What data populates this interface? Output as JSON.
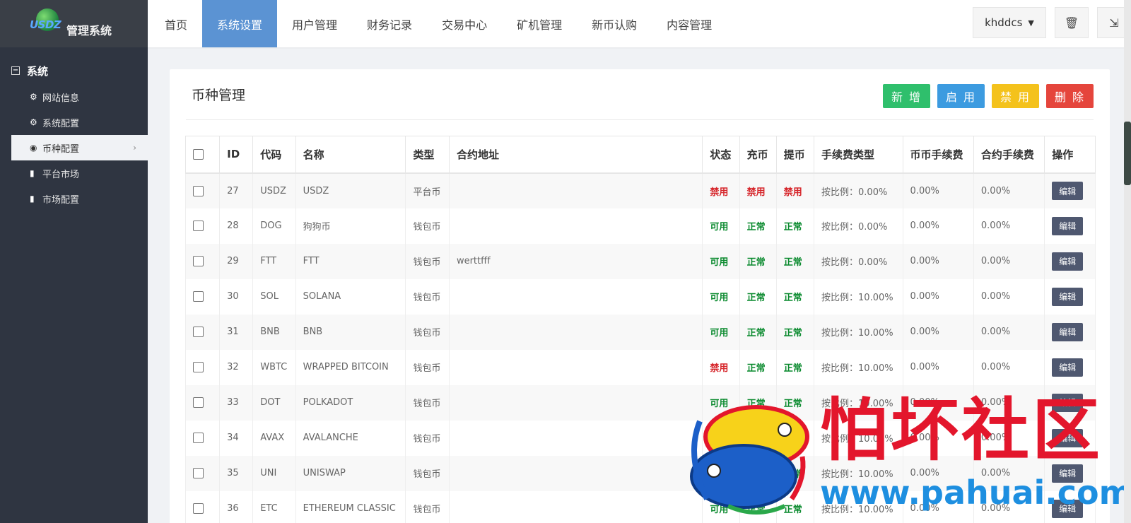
{
  "brand": {
    "logo_text": "USDZ",
    "system_name": "管理系统"
  },
  "nav": [
    "首页",
    "系统设置",
    "用户管理",
    "财务记录",
    "交易中心",
    "矿机管理",
    "新币认购",
    "内容管理"
  ],
  "active_nav": 1,
  "user": {
    "name": "khddcs"
  },
  "sidebar": {
    "group": "系统",
    "items": [
      {
        "label": "网站信息",
        "icon": "gear-icon"
      },
      {
        "label": "系统配置",
        "icon": "gear-icon"
      },
      {
        "label": "币种配置",
        "icon": "target-icon"
      },
      {
        "label": "平台市场",
        "icon": "bar-chart-icon"
      },
      {
        "label": "市场配置",
        "icon": "bar-chart-icon"
      }
    ]
  },
  "page": {
    "title": "币种管理",
    "buttons": {
      "add": "新 增",
      "enable": "启 用",
      "disable": "禁 用",
      "delete": "删 除"
    }
  },
  "table": {
    "columns": [
      "ID",
      "代码",
      "名称",
      "类型",
      "合约地址",
      "状态",
      "充币",
      "提币",
      "手续费类型",
      "币币手续费",
      "合约手续费",
      "操作"
    ],
    "edit_label": "编辑",
    "rows": [
      {
        "id": "27",
        "code": "USDZ",
        "name": "USDZ",
        "type": "平台币",
        "contract": "",
        "status": "禁用",
        "deposit": "禁用",
        "withdraw": "禁用",
        "fee_type": "按比例：0.00%",
        "spot_fee": "0.00%",
        "contract_fee": "0.00%"
      },
      {
        "id": "28",
        "code": "DOG",
        "name": "狗狗币",
        "type": "钱包币",
        "contract": "",
        "status": "可用",
        "deposit": "正常",
        "withdraw": "正常",
        "fee_type": "按比例：0.00%",
        "spot_fee": "0.00%",
        "contract_fee": "0.00%"
      },
      {
        "id": "29",
        "code": "FTT",
        "name": "FTT",
        "type": "钱包币",
        "contract": "werttfff",
        "status": "可用",
        "deposit": "正常",
        "withdraw": "正常",
        "fee_type": "按比例：0.00%",
        "spot_fee": "0.00%",
        "contract_fee": "0.00%"
      },
      {
        "id": "30",
        "code": "SOL",
        "name": "SOLANA",
        "type": "钱包币",
        "contract": "",
        "status": "可用",
        "deposit": "正常",
        "withdraw": "正常",
        "fee_type": "按比例：10.00%",
        "spot_fee": "0.00%",
        "contract_fee": "0.00%"
      },
      {
        "id": "31",
        "code": "BNB",
        "name": "BNB",
        "type": "钱包币",
        "contract": "",
        "status": "可用",
        "deposit": "正常",
        "withdraw": "正常",
        "fee_type": "按比例：10.00%",
        "spot_fee": "0.00%",
        "contract_fee": "0.00%"
      },
      {
        "id": "32",
        "code": "WBTC",
        "name": "WRAPPED BITCOIN",
        "type": "钱包币",
        "contract": "",
        "status": "禁用",
        "deposit": "正常",
        "withdraw": "正常",
        "fee_type": "按比例：10.00%",
        "spot_fee": "0.00%",
        "contract_fee": "0.00%"
      },
      {
        "id": "33",
        "code": "DOT",
        "name": "POLKADOT",
        "type": "钱包币",
        "contract": "",
        "status": "可用",
        "deposit": "正常",
        "withdraw": "正常",
        "fee_type": "按比例：10.00%",
        "spot_fee": "0.00%",
        "contract_fee": "0.00%"
      },
      {
        "id": "34",
        "code": "AVAX",
        "name": "AVALANCHE",
        "type": "钱包币",
        "contract": "",
        "status": "可用",
        "deposit": "正常",
        "withdraw": "正常",
        "fee_type": "按比例：10.00%",
        "spot_fee": "0.00%",
        "contract_fee": "0.00%"
      },
      {
        "id": "35",
        "code": "UNI",
        "name": "UNISWAP",
        "type": "钱包币",
        "contract": "",
        "status": "可用",
        "deposit": "正常",
        "withdraw": "正常",
        "fee_type": "按比例：10.00%",
        "spot_fee": "0.00%",
        "contract_fee": "0.00%"
      },
      {
        "id": "36",
        "code": "ETC",
        "name": "ETHEREUM CLASSIC",
        "type": "钱包币",
        "contract": "",
        "status": "可用",
        "deposit": "正常",
        "withdraw": "正常",
        "fee_type": "按比例：10.00%",
        "spot_fee": "0.00%",
        "contract_fee": "0.00%"
      }
    ]
  },
  "watermark": {
    "cn": "怕坏社区",
    "url": "www.pahuai.com"
  },
  "colors": {
    "sidebar": "#2f3541",
    "nav_active": "#5b93d3",
    "ok": "#0a8a2e",
    "bad": "#d6262b",
    "edit": "#4f5870"
  }
}
